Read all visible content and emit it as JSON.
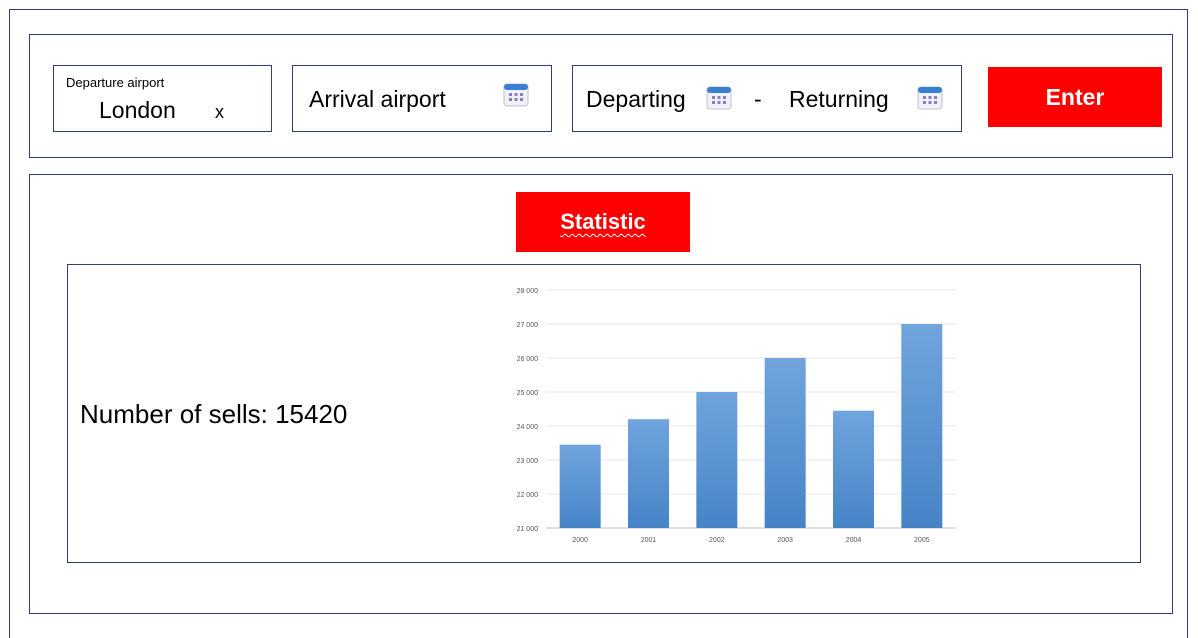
{
  "search": {
    "departure": {
      "label": "Departure airport",
      "value": "London",
      "clear": "x"
    },
    "arrival": {
      "label": "Arrival airport"
    },
    "dates": {
      "departing": "Departing",
      "separator": "-",
      "returning": "Returning"
    },
    "enter_label": "Enter"
  },
  "stats": {
    "button_label": "Statistic",
    "sells_text": "Number of sells: 15420"
  },
  "colors": {
    "accent": "#ff0000",
    "border": "#2f3f6f",
    "bar_top": "#6fa3dc",
    "bar_bottom": "#4a86c8"
  },
  "icons": {
    "calendar": "calendar-icon"
  },
  "chart_data": {
    "type": "bar",
    "categories": [
      "2000",
      "2001",
      "2002",
      "2003",
      "2004",
      "2005"
    ],
    "values": [
      23450,
      24200,
      25000,
      26000,
      24450,
      27000
    ],
    "ylim": [
      21000,
      28000
    ],
    "yticks": [
      "21 000",
      "22 000",
      "23 000",
      "24 000",
      "25 000",
      "26 000",
      "27 000",
      "28 000"
    ],
    "grid": true
  }
}
